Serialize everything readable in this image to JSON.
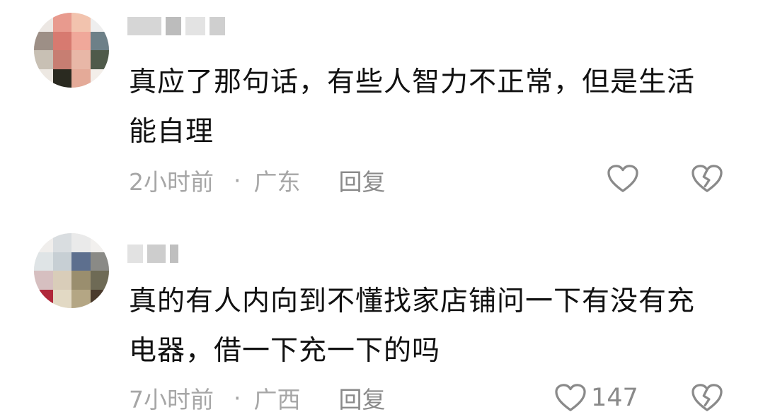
{
  "comments": [
    {
      "text": "真应了那句话，有些人智力不正常，但是生活能自理",
      "time": "2小时前",
      "separator": "·",
      "location": "广东",
      "reply_label": "回复",
      "likes": "",
      "like_icon": "heart-outline-icon",
      "dislike_icon": "broken-heart-icon"
    },
    {
      "text": "真的有人内向到不懂找家店铺问一下有没有充电器，借一下充一下的吗",
      "time": "7小时前",
      "separator": "·",
      "location": "广西",
      "reply_label": "回复",
      "likes": "147",
      "like_icon": "heart-outline-icon",
      "dislike_icon": "broken-heart-icon"
    }
  ],
  "colors": {
    "text": "#111111",
    "meta": "#a6a6a6",
    "icon": "#8a8a8a",
    "background": "#ffffff"
  }
}
